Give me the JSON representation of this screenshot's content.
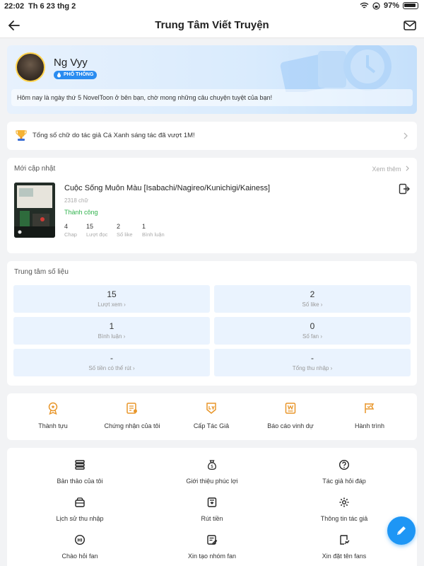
{
  "status_bar": {
    "time": "22:02",
    "date": "Th 6 23 thg 2",
    "battery": "97%"
  },
  "header": {
    "title": "Trung Tâm Viết Truyện"
  },
  "profile": {
    "name": "Ng Vyy",
    "level_badge": "PHỔ THÔNG",
    "welcome_text": "Hôm nay là ngày thứ 5 NovelToon ở bên bạn, chờ mong những câu chuyện tuyệt của bạn!"
  },
  "notice": {
    "text": "Tổng số chữ do tác giả Cá Xanh sáng tác đã vượt 1M!"
  },
  "recent": {
    "section_title": "Mới cập nhật",
    "see_more": "Xem thêm",
    "book": {
      "title": "Cuộc Sống Muôn Màu [Isabachi/Nagireo/Kunichigi/Kainess]",
      "words": "2318 chữ",
      "status": "Thành công",
      "stats": [
        {
          "value": "4",
          "label": "Chap"
        },
        {
          "value": "15",
          "label": "Lượt đọc"
        },
        {
          "value": "2",
          "label": "Số like"
        },
        {
          "value": "1",
          "label": "Bình luận"
        }
      ]
    }
  },
  "data_center": {
    "section_title": "Trung tâm số liệu",
    "tiles": [
      {
        "value": "15",
        "label": "Lượt xem"
      },
      {
        "value": "2",
        "label": "Số like"
      },
      {
        "value": "1",
        "label": "Bình luận"
      },
      {
        "value": "0",
        "label": "Số fan"
      },
      {
        "value": "-",
        "label": "Số tiền có thể rút"
      },
      {
        "value": "-",
        "label": "Tổng thu nhập"
      }
    ]
  },
  "quick_links": [
    {
      "label": "Thành tựu",
      "icon": "medal-icon"
    },
    {
      "label": "Chứng nhận của tôi",
      "icon": "certificate-icon"
    },
    {
      "label": "Cấp Tác Giả",
      "icon": "level-icon"
    },
    {
      "label": "Báo cáo vinh dự",
      "icon": "honor-report-icon"
    },
    {
      "label": "Hành trình",
      "icon": "journey-icon"
    }
  ],
  "menu": [
    {
      "label": "Bản thảo của tôi",
      "icon": "stack-icon"
    },
    {
      "label": "Giới thiệu phúc lợi",
      "icon": "money-bag-icon"
    },
    {
      "label": "Tác giả hỏi đáp",
      "icon": "question-icon"
    },
    {
      "label": "Lịch sử thu nhập",
      "icon": "wallet-icon"
    },
    {
      "label": "Rút tiền",
      "icon": "withdraw-icon"
    },
    {
      "label": "Thông tin tác giả",
      "icon": "gear-icon"
    },
    {
      "label": "Chào hỏi fan",
      "icon": "hi-icon"
    },
    {
      "label": "Xin tạo nhóm fan",
      "icon": "form-icon"
    },
    {
      "label": "Xin đặt tên fans",
      "icon": "name-tag-icon"
    }
  ],
  "colors": {
    "accent": "#1e96f5",
    "success": "#2fb24c",
    "icon_orange": "#e8962a",
    "tile_bg": "#eaf3fe"
  }
}
